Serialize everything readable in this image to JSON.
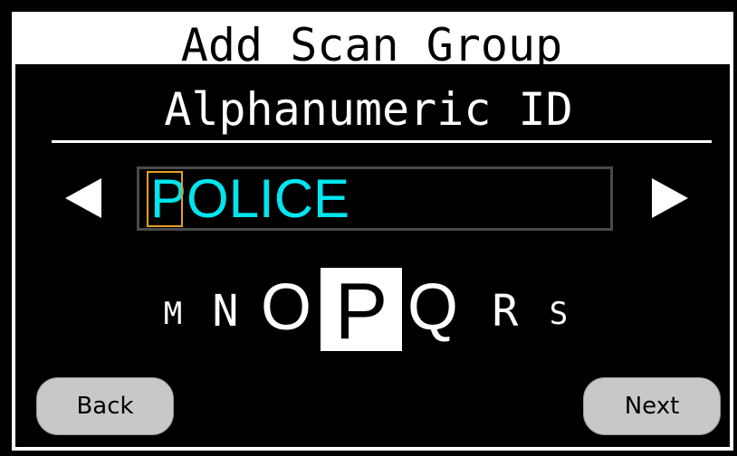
{
  "header": {
    "title": "Add Scan Group"
  },
  "field": {
    "label": "Alphanumeric ID",
    "value": "POLICE",
    "cursor_position": 0
  },
  "char_picker": {
    "chars": [
      "M",
      "N",
      "O",
      "P",
      "Q",
      "R",
      "S"
    ],
    "selected": "P"
  },
  "icons": {
    "prev": "left-arrow-icon",
    "next": "right-arrow-icon"
  },
  "buttons": {
    "back_label": "Back",
    "next_label": "Next"
  },
  "colors": {
    "background": "#000000",
    "text": "#ffffff",
    "field_text": "#00e5ee",
    "cursor": "#e6a020",
    "button": "#c8c8c8"
  }
}
